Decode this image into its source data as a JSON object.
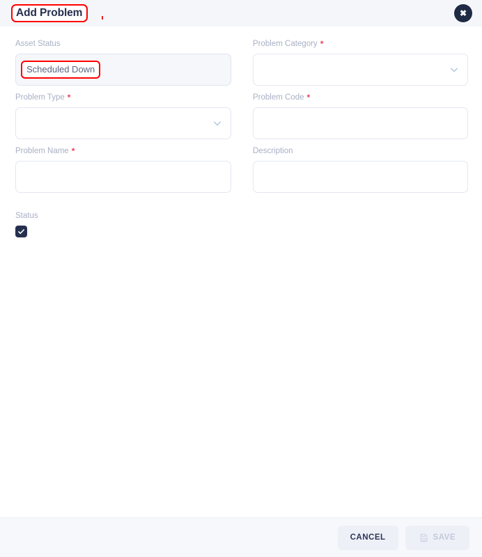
{
  "dialog": {
    "title": "Add Problem",
    "close_icon": "close-icon",
    "annotation_dot": ""
  },
  "form": {
    "fields": [
      {
        "label": "Asset Status",
        "required": false,
        "type": "readonly-text",
        "value": "Scheduled Down",
        "placeholder": "",
        "highlighted": true
      },
      {
        "label": "Problem Category",
        "required": true,
        "type": "select",
        "value": "",
        "placeholder": "",
        "icon": "chevron-down-icon"
      },
      {
        "label": "Problem Type",
        "required": true,
        "type": "select",
        "value": "",
        "placeholder": "",
        "icon": "chevron-down-icon"
      },
      {
        "label": "Problem Code",
        "required": true,
        "type": "text",
        "value": "",
        "placeholder": ""
      },
      {
        "label": "Problem Name",
        "required": true,
        "type": "text",
        "value": "",
        "placeholder": ""
      },
      {
        "label": "Description",
        "required": false,
        "type": "text",
        "value": "",
        "placeholder": ""
      }
    ],
    "status": {
      "label": "Status",
      "checked": true,
      "checkbox_icon": "check-icon"
    }
  },
  "footer": {
    "cancel_label": "CANCEL",
    "save_label": "SAVE",
    "save_icon": "save-disk-icon",
    "save_disabled": true
  },
  "colors": {
    "header_bg": "#f5f6fa",
    "accent_dark": "#26304e",
    "required_star": "#ef4056",
    "highlight_box": "#ff0000",
    "label_text": "#a8b0c4",
    "border": "#e3e7f0",
    "footer_bg": "#f7f8fc"
  }
}
